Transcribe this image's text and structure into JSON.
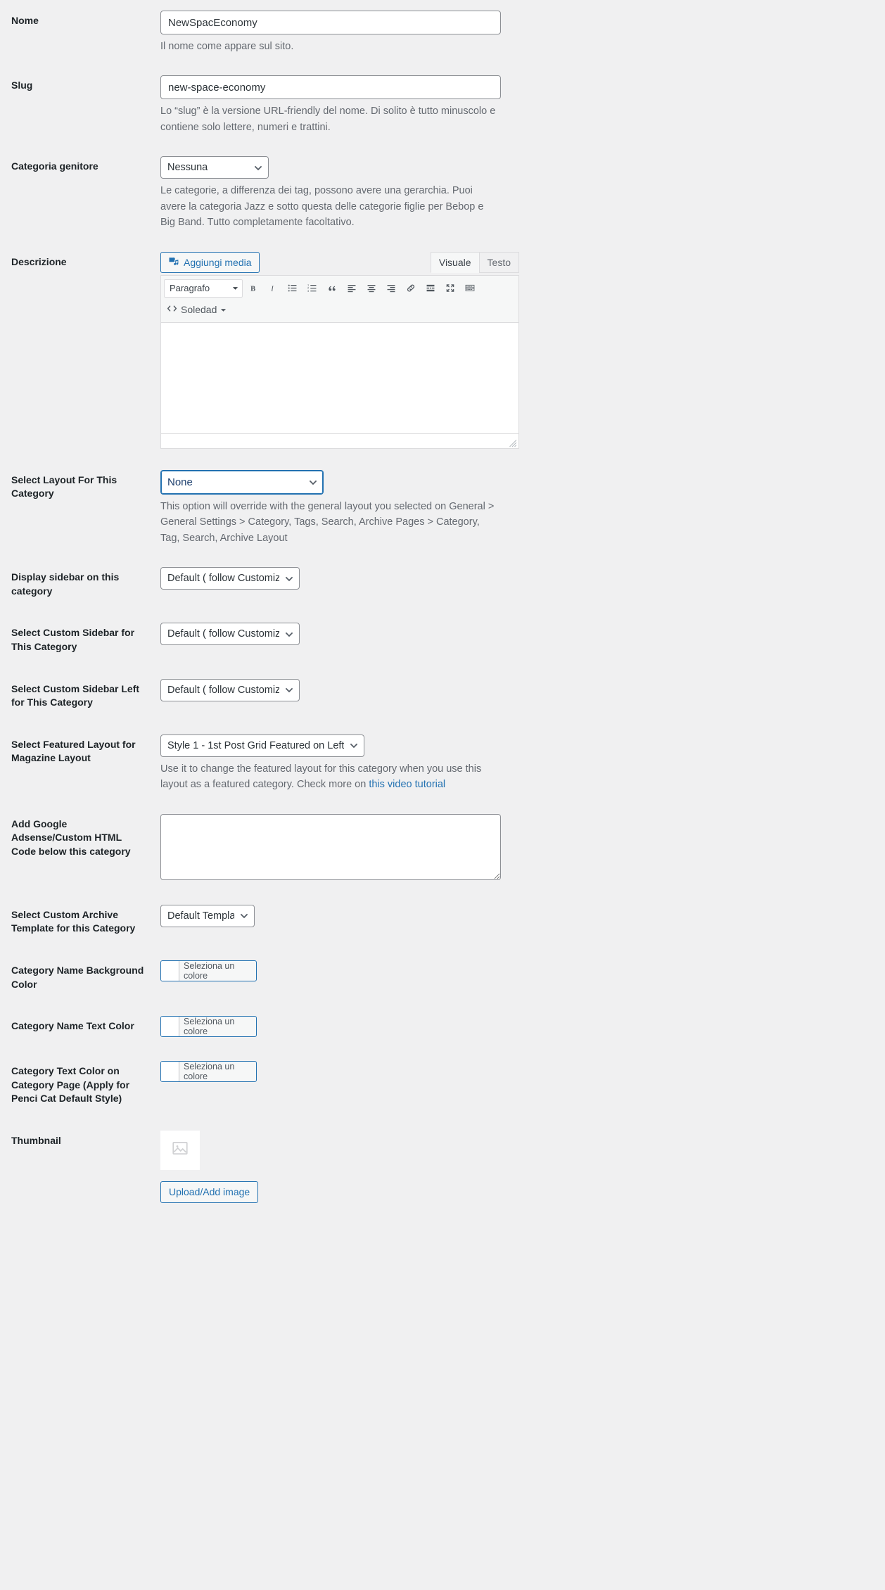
{
  "fields": {
    "name": {
      "label": "Nome",
      "value": "NewSpacEconomy",
      "description": "Il nome come appare sul sito."
    },
    "slug": {
      "label": "Slug",
      "value": "new-space-economy",
      "description": "Lo “slug” è la versione URL-friendly del nome. Di solito è tutto minuscolo e contiene solo lettere, numeri e trattini."
    },
    "parent": {
      "label": "Categoria genitore",
      "value": "Nessuna",
      "description": "Le categorie, a differenza dei tag, possono avere una gerarchia. Puoi avere la categoria Jazz e sotto questa delle categorie figlie per Bebop e Big Band. Tutto completamente facoltativo."
    },
    "description": {
      "label": "Descrizione",
      "add_media_label": "Aggiungi media",
      "tab_visual": "Visuale",
      "tab_text": "Testo",
      "format_select": "Paragrafo",
      "soledad_label": "Soledad",
      "content": ""
    },
    "layout": {
      "label": "Select Layout For This Category",
      "value": "None",
      "description": "This option will override with the general layout you selected on General > General Settings > Category, Tags, Search, Archive Pages > Category, Tag, Search, Archive Layout"
    },
    "display_sidebar": {
      "label": "Display sidebar on this category",
      "value": "Default ( follow Customize )"
    },
    "custom_sidebar": {
      "label": "Select Custom Sidebar for This Category",
      "value": "Default ( follow Customize )"
    },
    "custom_sidebar_left": {
      "label": "Select Custom Sidebar Left for This Category",
      "value": "Default ( follow Customize )"
    },
    "featured_layout": {
      "label": "Select Featured Layout for Magazine Layout",
      "value": "Style 1 - 1st Post Grid Featured on Left",
      "description_before": "Use it to change the featured layout for this category when you use this layout as a featured category. Check more on ",
      "link_text": "this video tutorial"
    },
    "adsense": {
      "label": "Add Google Adsense/Custom HTML Code below this category",
      "value": ""
    },
    "archive_template": {
      "label": "Select Custom Archive Template for this Category",
      "value": "Default Template"
    },
    "cat_bg_color": {
      "label": "Category Name Background Color",
      "button_label": "Seleziona un colore"
    },
    "cat_text_color": {
      "label": "Category Name Text Color",
      "button_label": "Seleziona un colore"
    },
    "cat_page_text_color": {
      "label": "Category Text Color on Category Page (Apply for Penci Cat Default Style)",
      "button_label": "Seleziona un colore"
    },
    "thumbnail": {
      "label": "Thumbnail",
      "upload_label": "Upload/Add image"
    }
  },
  "colors": {
    "accent": "#2271b1",
    "page_bg": "#f0f0f1",
    "label_text": "#1d2327",
    "desc_text": "#646970",
    "border": "#8c8f94"
  }
}
